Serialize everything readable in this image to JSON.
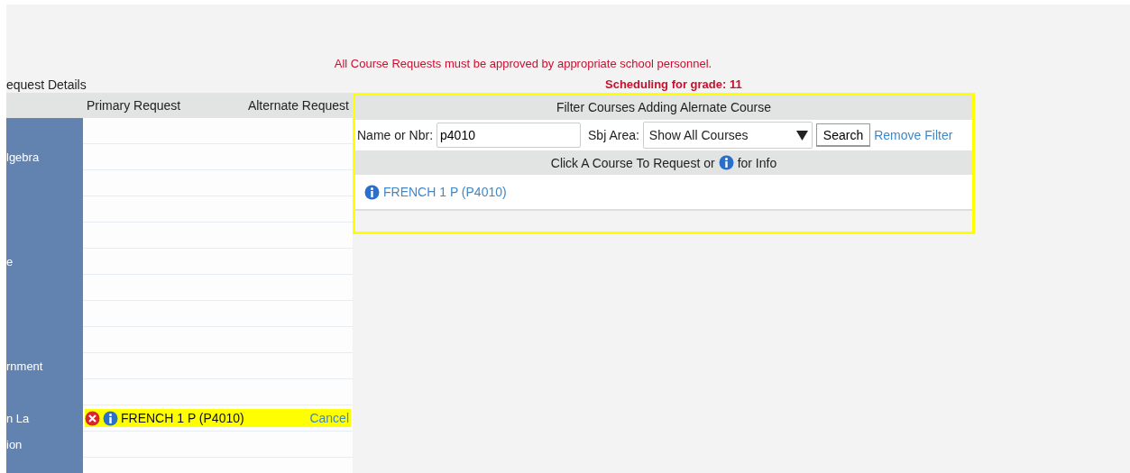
{
  "notice": "All Course Requests must be approved by appropriate school personnel.",
  "grade_note": "Scheduling for grade: 11",
  "section_title": "equest Details",
  "request_table": {
    "columns": [
      "Primary Request",
      "Alternate Request"
    ],
    "rows": [
      {},
      {
        "label": "lgebra"
      },
      {},
      {},
      {},
      {
        "label": "e"
      },
      {},
      {},
      {},
      {
        "label": "rnment"
      },
      {},
      {
        "label": "n La",
        "primary": "FRENCH 1 P (P4010)",
        "action": "Cancel",
        "highlighted": true
      },
      {
        "label": "ion"
      },
      {}
    ]
  },
  "filter_panel": {
    "title": "Filter Courses Adding Alernate Course",
    "name_label": "Name or Nbr:",
    "name_value": "p4010",
    "subject_label": "Sbj Area:",
    "subject_value": "Show All Courses",
    "search_button": "Search",
    "remove_filter": "Remove Filter",
    "hint_before": "Click A Course To Request or",
    "hint_after": "for Info",
    "results": [
      {
        "course": "FRENCH 1 P (P4010)"
      }
    ]
  }
}
